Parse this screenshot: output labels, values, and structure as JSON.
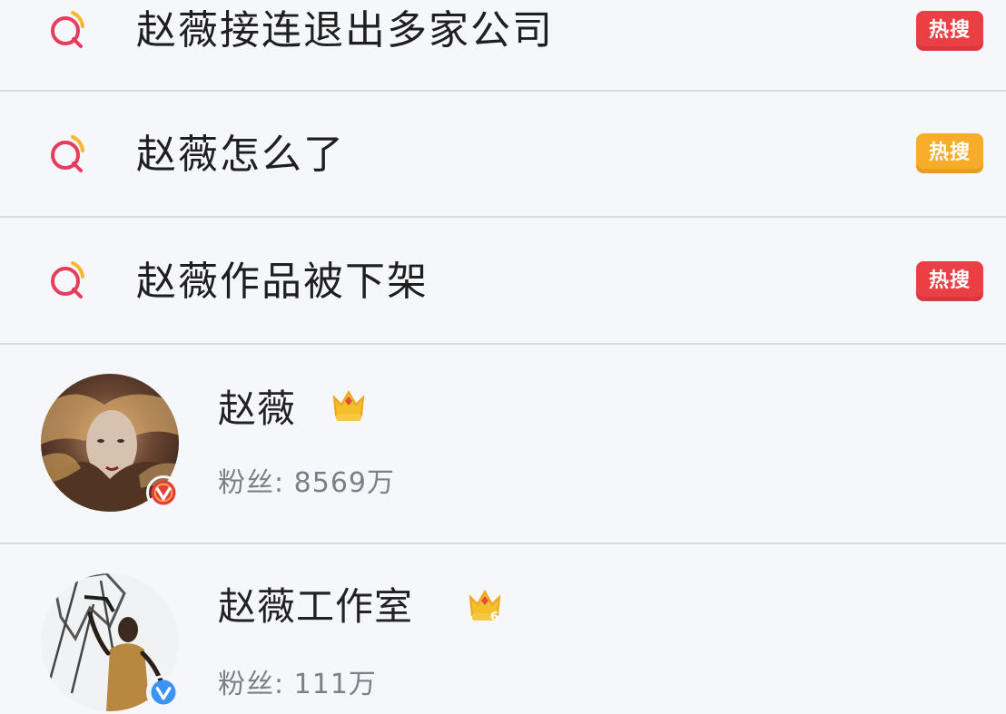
{
  "suggestions": [
    {
      "text": "赵薇接连退出多家公司",
      "badge": "热搜",
      "badge_color": "#ea3f44"
    },
    {
      "text": "赵薇怎么了",
      "badge": "热搜",
      "badge_color": "#f7ad29"
    },
    {
      "text": "赵薇作品被下架",
      "badge": "热搜",
      "badge_color": "#ea3f44"
    }
  ],
  "users": [
    {
      "name": "赵薇",
      "followers_label": "粉丝:",
      "followers_value": "8569万",
      "verified_color": "#e53e3f",
      "crown_level": "",
      "avatar_desc": "avatar-photo"
    },
    {
      "name": "赵薇工作室",
      "followers_label": "粉丝:",
      "followers_value": "111万",
      "verified_color": "#3a93f5",
      "crown_level": "6",
      "avatar_desc": "avatar-photo"
    }
  ],
  "colors": {
    "background": "#f5f6fb",
    "divider": "#d9dbe1",
    "search_icon_red": "#e73d5c",
    "search_icon_yellow": "#f7b72f",
    "muted_text": "#7c7f87"
  }
}
